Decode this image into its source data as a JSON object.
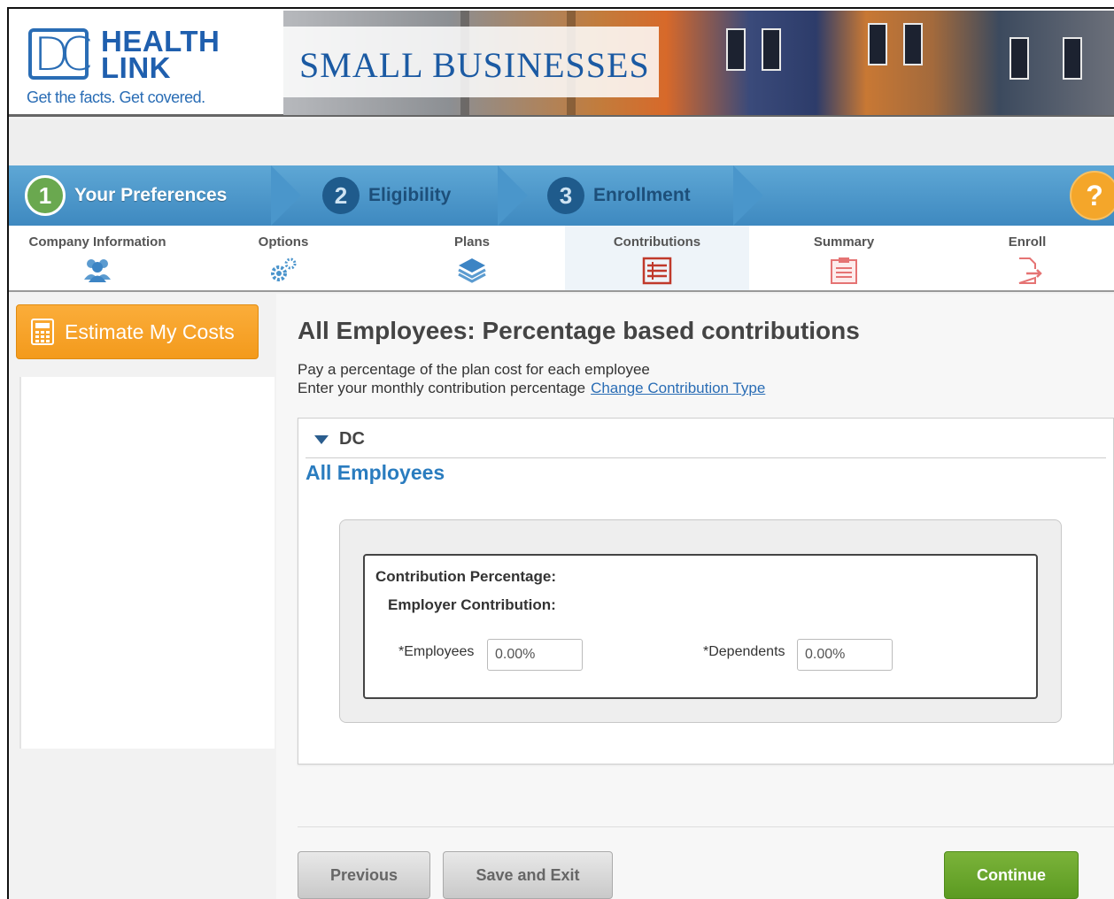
{
  "header": {
    "logo_dc": "DC",
    "logo_line1": "HEALTH",
    "logo_line2": "LINK",
    "logo_tagline": "Get the facts. Get covered.",
    "banner_title": "SMALL BUSINESSES"
  },
  "steps": [
    {
      "number": "1",
      "label": "Your Preferences",
      "state": "active"
    },
    {
      "number": "2",
      "label": "Eligibility",
      "state": "inactive"
    },
    {
      "number": "3",
      "label": "Enrollment",
      "state": "inactive"
    }
  ],
  "help_label": "?",
  "subtabs": [
    {
      "label": "Company Information",
      "icon": "users-icon"
    },
    {
      "label": "Options",
      "icon": "gears-icon"
    },
    {
      "label": "Plans",
      "icon": "layers-icon"
    },
    {
      "label": "Contributions",
      "icon": "list-icon",
      "active": true
    },
    {
      "label": "Summary",
      "icon": "clipboard-icon"
    },
    {
      "label": "Enroll",
      "icon": "export-icon"
    }
  ],
  "sidebar": {
    "estimate_button": "Estimate My Costs",
    "estimate_icon": "calculator-icon"
  },
  "main": {
    "title": "All Employees: Percentage based contributions",
    "desc_line1": "Pay a percentage of the plan cost for each employee",
    "desc_line2": "Enter your monthly contribution percentage",
    "change_link": "Change Contribution Type",
    "region": "DC",
    "group_title": "All Employees",
    "contribution_percentage_label": "Contribution Percentage:",
    "employer_contribution_label": "Employer Contribution:",
    "employees_label": "*Employees",
    "employees_value": "0.00%",
    "dependents_label": "*Dependents",
    "dependents_value": "0.00%"
  },
  "buttons": {
    "previous": "Previous",
    "save_exit": "Save and Exit",
    "continue": "Continue"
  },
  "colors": {
    "brand_blue": "#2a6db5",
    "step_bar": "#4a94c8",
    "estimate_orange": "#f6a024",
    "continue_green": "#6aa52c",
    "help_orange": "#f4a62a",
    "group_title_blue": "#2a7cbf"
  }
}
